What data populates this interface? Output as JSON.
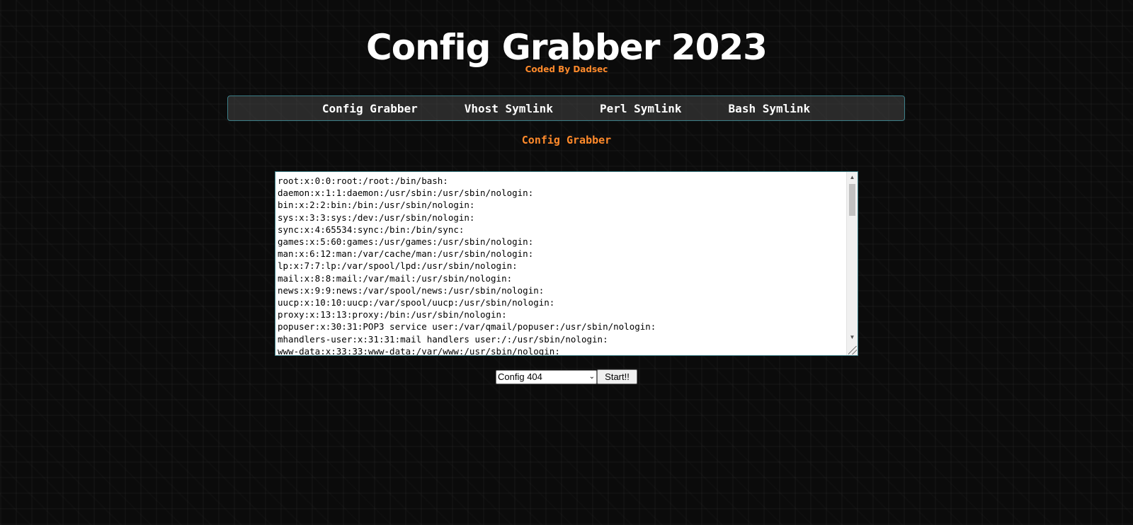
{
  "header": {
    "title": "Config Grabber 2023",
    "subtitle": "Coded By Dadsec"
  },
  "nav": {
    "items": [
      {
        "label": "Config Grabber"
      },
      {
        "label": "Vhost Symlink"
      },
      {
        "label": "Perl Symlink"
      },
      {
        "label": "Bash Symlink"
      }
    ]
  },
  "section": {
    "title": "Config Grabber"
  },
  "output": {
    "text": "root:x:0:0:root:/root:/bin/bash:\ndaemon:x:1:1:daemon:/usr/sbin:/usr/sbin/nologin:\nbin:x:2:2:bin:/bin:/usr/sbin/nologin:\nsys:x:3:3:sys:/dev:/usr/sbin/nologin:\nsync:x:4:65534:sync:/bin:/bin/sync:\ngames:x:5:60:games:/usr/games:/usr/sbin/nologin:\nman:x:6:12:man:/var/cache/man:/usr/sbin/nologin:\nlp:x:7:7:lp:/var/spool/lpd:/usr/sbin/nologin:\nmail:x:8:8:mail:/var/mail:/usr/sbin/nologin:\nnews:x:9:9:news:/var/spool/news:/usr/sbin/nologin:\nuucp:x:10:10:uucp:/var/spool/uucp:/usr/sbin/nologin:\nproxy:x:13:13:proxy:/bin:/usr/sbin/nologin:\npopuser:x:30:31:POP3 service user:/var/qmail/popuser:/usr/sbin/nologin:\nmhandlers-user:x:31:31:mail handlers user:/:/usr/sbin/nologin:\nwww-data:x:33:33:www-data:/var/www:/usr/sbin/nologin:"
  },
  "controls": {
    "select_value": "Config 404",
    "start_label": "Start!!"
  },
  "colors": {
    "accent": "#ff8a2b",
    "border": "#3c7f88",
    "background": "#0b0b0b"
  }
}
